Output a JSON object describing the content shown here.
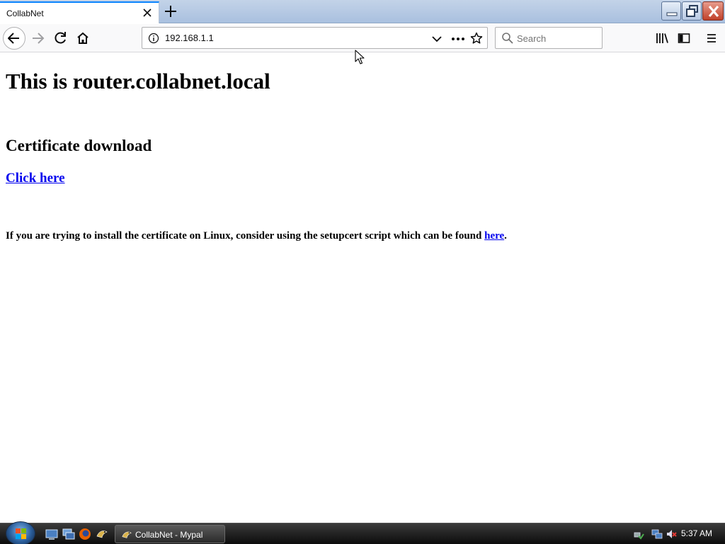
{
  "tab": {
    "title": "CollabNet"
  },
  "urlbar": {
    "url": "192.168.1.1"
  },
  "search": {
    "placeholder": "Search"
  },
  "page": {
    "title": "This is router.collabnet.local",
    "cert_heading": "Certificate download",
    "cert_link": "Click here",
    "linux_note_prefix": "If you are trying to install the certificate on Linux, consider using the setupcert script which can be found ",
    "linux_note_link": "here",
    "linux_note_suffix": "."
  },
  "taskbar": {
    "task_label": "CollabNet - Mypal",
    "clock": "5:37 AM"
  },
  "colors": {
    "link": "#0000ee",
    "tab_accent": "#0a84ff",
    "titlebar": "#a9c0df",
    "close_button": "#c0412a"
  },
  "icons": {
    "tab_close": "close-icon",
    "new_tab": "plus-icon",
    "back": "arrow-left-icon",
    "forward": "arrow-right-icon",
    "reload": "reload-icon",
    "home": "home-icon",
    "site_info": "info-icon",
    "url_dropdown": "chevron-down-icon",
    "page_actions": "ellipsis-icon",
    "bookmark": "star-icon",
    "search": "search-icon",
    "library": "library-icon",
    "sidebar": "sidebar-icon",
    "menu": "hamburger-menu-icon"
  }
}
